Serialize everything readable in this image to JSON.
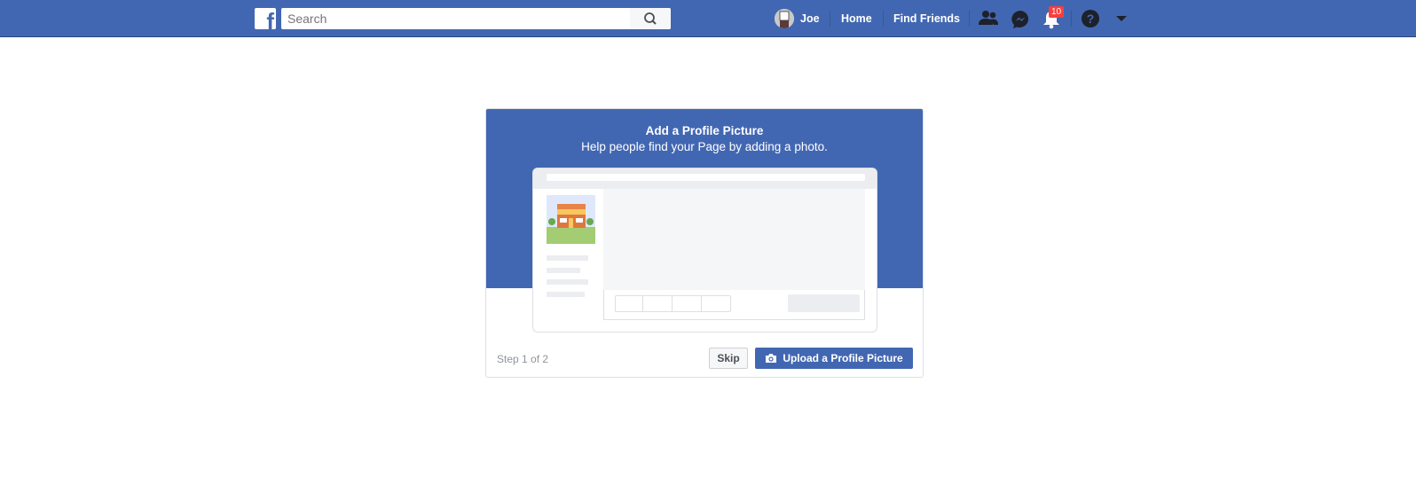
{
  "header": {
    "logo": "f",
    "search_placeholder": "Search",
    "user_name": "Joe",
    "home": "Home",
    "find_friends": "Find Friends",
    "notification_count": "10",
    "brand_color": "#4267b2"
  },
  "card": {
    "title": "Add a Profile Picture",
    "subtitle": "Help people find your Page by adding a photo.",
    "step": "Step 1 of 2",
    "skip_label": "Skip",
    "upload_label": "Upload a Profile Picture"
  }
}
